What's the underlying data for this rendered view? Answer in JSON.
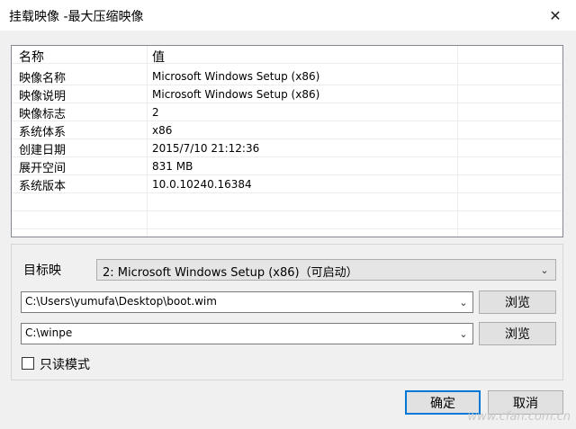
{
  "window": {
    "title": "挂载映像 -最大压缩映像",
    "close_glyph": "✕"
  },
  "table": {
    "header": {
      "name": "名称",
      "value": "值"
    },
    "rows": [
      {
        "name": "映像名称",
        "value": "Microsoft Windows Setup (x86)"
      },
      {
        "name": "映像说明",
        "value": "Microsoft Windows Setup (x86)"
      },
      {
        "name": "映像标志",
        "value": "2"
      },
      {
        "name": "系统体系",
        "value": "x86"
      },
      {
        "name": "创建日期",
        "value": "2015/7/10 21:12:36"
      },
      {
        "name": "展开空间",
        "value": "831 MB"
      },
      {
        "name": "系统版本",
        "value": "10.0.10240.16384"
      }
    ]
  },
  "target": {
    "label": "目标映",
    "selected": "2: Microsoft Windows Setup (x86)（可启动）"
  },
  "source_path": {
    "value": "C:\\Users\\yumufa\\Desktop\\boot.wim",
    "browse_label": "浏览"
  },
  "mount_path": {
    "value": "C:\\winpe",
    "browse_label": "浏览"
  },
  "readonly": {
    "label": "只读模式",
    "checked": false
  },
  "buttons": {
    "ok": "确定",
    "cancel": "取消"
  },
  "watermark": "www.cfan.com.cn",
  "colors": {
    "accent": "#0078d7",
    "border": "#adadad"
  },
  "icons": {
    "dropdown": "chevron-down-icon",
    "close": "close-icon"
  }
}
